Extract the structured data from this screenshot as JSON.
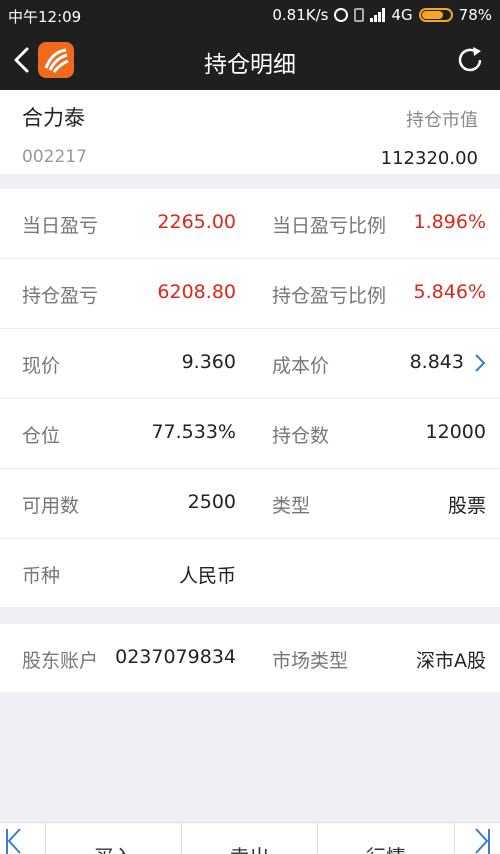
{
  "status": {
    "carrier_time": "中午12:09",
    "speed": "0.81K/s",
    "network": "4G",
    "battery": "78%",
    "battery_level": 0.78
  },
  "nav": {
    "title": "持仓明细",
    "icons": [
      "chevron-left-icon",
      "app-logo",
      "refresh-icon"
    ]
  },
  "stock": {
    "name": "合力泰",
    "code": "002217",
    "market_value_label": "持仓市值",
    "market_value": "112320.00"
  },
  "details": [
    {
      "label1": "当日盈亏",
      "value1": "2265.00",
      "label2": "当日盈亏比例",
      "value2": "1.896%",
      "red": true
    },
    {
      "label1": "持仓盈亏",
      "value1": "6208.80",
      "label2": "持仓盈亏比例",
      "value2": "5.846%",
      "red": true
    },
    {
      "label1": "现价",
      "value1": "9.360",
      "label2": "成本价",
      "value2": "8.843"
    },
    {
      "label1": "仓位",
      "value1": "77.533%",
      "label2": "持仓数",
      "value2": "12000"
    },
    {
      "label1": "可用数",
      "value1": "2500",
      "label2": "类型",
      "value2": "股票"
    },
    {
      "label1": "币种",
      "value1": "人民币"
    }
  ],
  "account": {
    "label1": "股东账户",
    "value1": "0237079834",
    "label2": "市场类型",
    "value2": "深市A股"
  },
  "bottom": {
    "buy": "买入",
    "sell": "卖出",
    "quote": "行情"
  },
  "colors": {
    "red": "#e0261b",
    "accent_blue": "#3a7bd5",
    "brand_orange": "#f06a1d"
  }
}
